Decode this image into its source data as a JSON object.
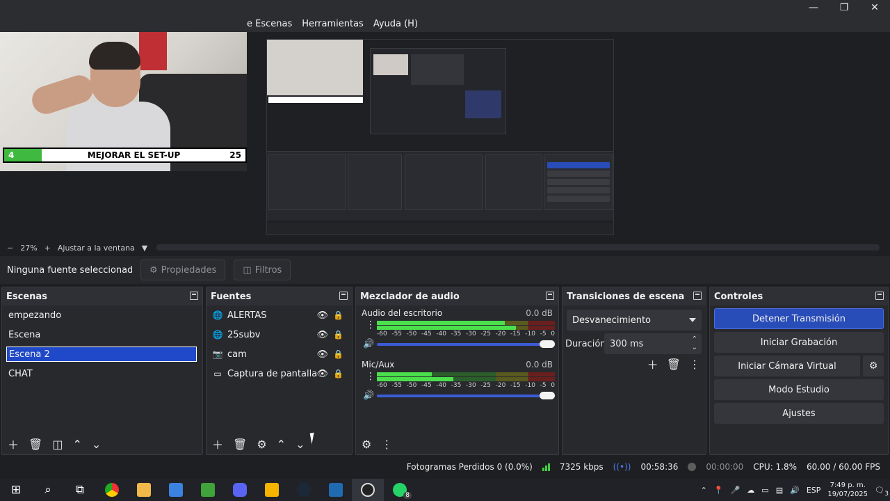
{
  "menubar": {
    "items": [
      "e Escenas",
      "Herramientas",
      "Ayuda (H)"
    ]
  },
  "window_controls": {
    "minimize": "—",
    "restore": "❐",
    "close": "✕"
  },
  "overlay": {
    "goal_current": "4",
    "goal_title": "MEJORAR EL SET-UP",
    "goal_target": "25"
  },
  "zoom": {
    "minus": "−",
    "level": "27%",
    "plus": "+",
    "fit": "Ajustar a la ventana",
    "caret": "▼"
  },
  "source_toolbar": {
    "no_selection": "Ninguna fuente seleccionad",
    "properties": "Propiedades",
    "filters": "Filtros"
  },
  "scenes": {
    "title": "Escenas",
    "items": [
      "empezando",
      "Escena",
      "Escena 2",
      "CHAT"
    ],
    "selected_index": 2
  },
  "sources": {
    "title": "Fuentes",
    "items": [
      {
        "label": "ALERTAS",
        "icon": "browser-icon"
      },
      {
        "label": "25subv",
        "icon": "browser-icon"
      },
      {
        "label": "cam",
        "icon": "camera-icon"
      },
      {
        "label": "Captura de pantalla",
        "icon": "monitor-icon"
      }
    ]
  },
  "mixer": {
    "title": "Mezclador de audio",
    "ticks": [
      "-60",
      "-55",
      "-50",
      "-45",
      "-40",
      "-35",
      "-30",
      "-25",
      "-20",
      "-15",
      "-10",
      "-5",
      "0"
    ],
    "channels": [
      {
        "name": "Audio del escritorio",
        "db": "0.0 dB",
        "level1": 0.72,
        "level2": 0.78,
        "volume": 1.0
      },
      {
        "name": "Mic/Aux",
        "db": "0.0 dB",
        "level1": 0.31,
        "level2": 0.43,
        "volume": 1.0
      }
    ]
  },
  "transitions": {
    "title": "Transiciones de escena",
    "selected": "Desvanecimiento",
    "duration_label": "Duración",
    "duration_value": "300 ms"
  },
  "controls": {
    "title": "Controles",
    "stop_stream": "Detener Transmisión",
    "start_recording": "Iniciar Grabación",
    "start_virtualcam": "Iniciar Cámara Virtual",
    "studio_mode": "Modo Estudio",
    "settings": "Ajustes"
  },
  "status": {
    "dropped_frames": "Fotogramas Perdidos 0 (0.0%)",
    "bitrate": "7325 kbps",
    "stream_time": "00:58:36",
    "rec_time": "00:00:00",
    "cpu": "CPU: 1.8%",
    "fps": "60.00 / 60.00 FPS"
  },
  "taskbar": {
    "whatsapp_badge": "8",
    "lang": "ESP",
    "time": "7:49 p. m.",
    "date": "19/07/2025",
    "notif_count": "3"
  },
  "colors": {
    "accent": "#284cb8",
    "selection": "#1f49c8",
    "meter_green": "#4be04b",
    "goal_green": "#3fb93f"
  }
}
